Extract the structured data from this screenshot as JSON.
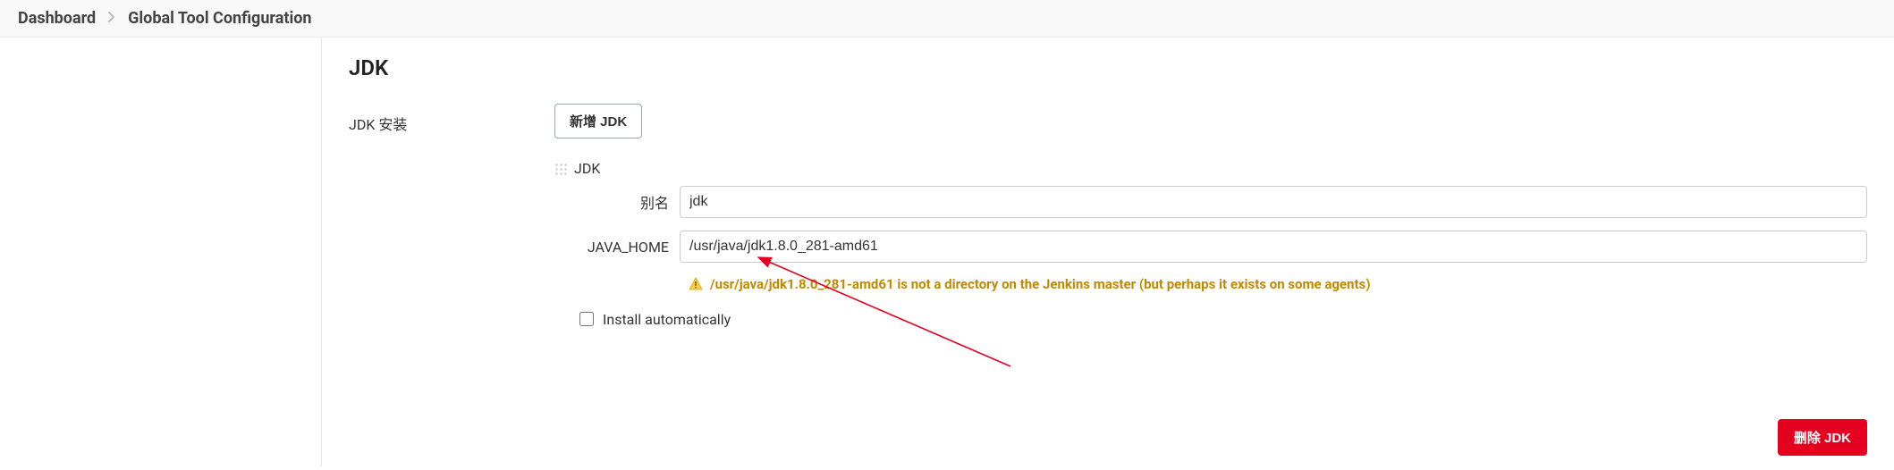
{
  "breadcrumbs": {
    "item0": "Dashboard",
    "item1": "Global Tool Configuration"
  },
  "section": {
    "title": "JDK",
    "install_label": "JDK 安装",
    "add_button": "新增 JDK",
    "installer_name": "JDK"
  },
  "fields": {
    "alias_label": "别名",
    "alias_value": "jdk",
    "java_home_label": "JAVA_HOME",
    "java_home_value": "/usr/java/jdk1.8.0_281-amd61"
  },
  "warning": {
    "text": "/usr/java/jdk1.8.0_281-amd61 is not a directory on the Jenkins master (but perhaps it exists on some agents)"
  },
  "install_auto": {
    "label": "Install automatically",
    "checked": false
  },
  "delete_button": "删除 JDK"
}
